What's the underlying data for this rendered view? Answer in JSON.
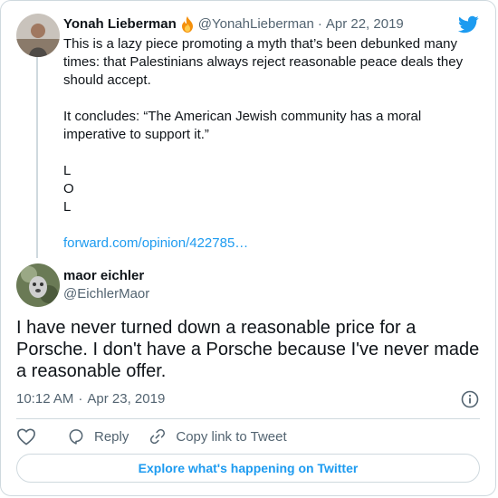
{
  "parent_tweet": {
    "author_name": "Yonah Lieberman",
    "author_emoji": "fire",
    "author_handle": "@YonahLieberman",
    "separator": "·",
    "date": "Apr 22, 2019",
    "paragraphs": [
      "This is a lazy piece promoting a myth that’s been debunked many times: that Palestinians always reject reasonable peace deals they should accept.",
      "It concludes: “The American Jewish community has a moral imperative to support it.”"
    ],
    "lol_lines": [
      "L",
      "O",
      "L"
    ],
    "link_text": "forward.com/opinion/422785…"
  },
  "tweet": {
    "author_name": "maor eichler",
    "author_handle": "@EichlerMaor",
    "text": "I have never turned down a reasonable price for a Porsche. I don't have a Porsche because I've never made a reasonable offer.",
    "time": "10:12 AM",
    "separator": "·",
    "date": "Apr 23, 2019"
  },
  "actions": {
    "like_icon": "heart-icon",
    "reply_label": "Reply",
    "copy_link_label": "Copy link to Tweet"
  },
  "explore_label": "Explore what's happening on Twitter",
  "colors": {
    "accent": "#1d9bf0",
    "secondary_text": "#536471",
    "border": "#cfd9de"
  },
  "icons": {
    "brand": "twitter-bird-icon",
    "info": "info-icon",
    "reply": "reply-icon",
    "link": "link-icon"
  }
}
